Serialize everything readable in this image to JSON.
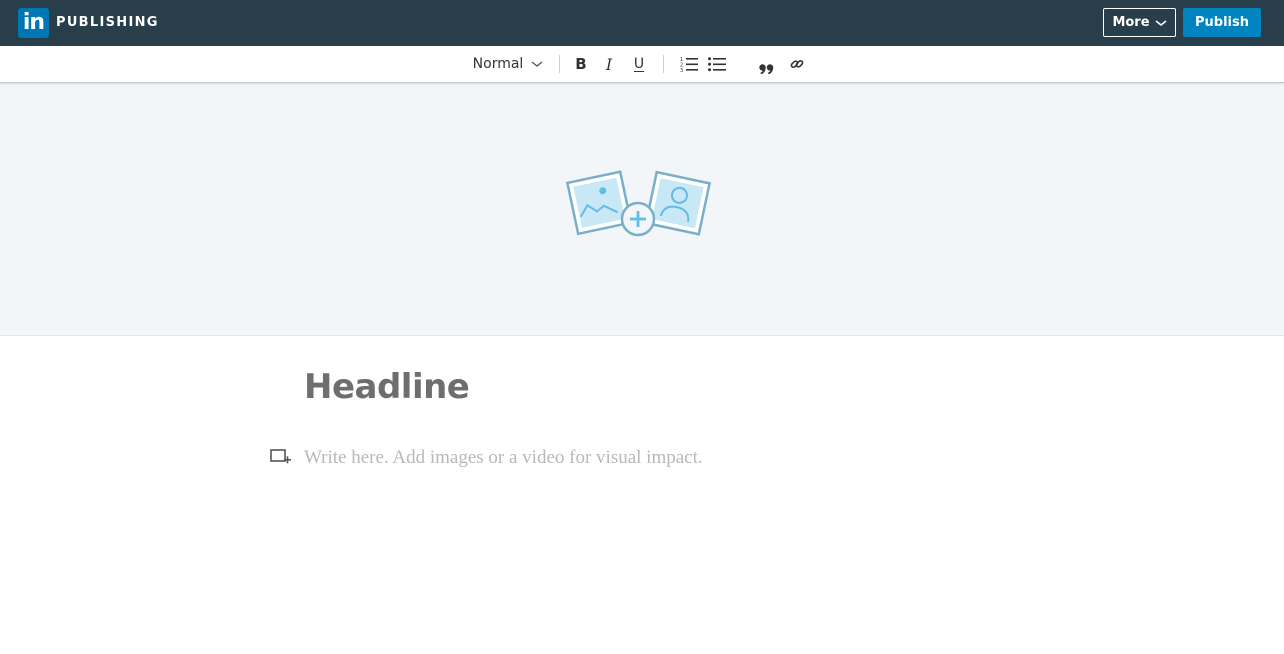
{
  "header": {
    "logo_text": "in",
    "brand": "PUBLISHING",
    "more_label": "More",
    "publish_label": "Publish"
  },
  "toolbar": {
    "style_selected": "Normal",
    "bold_glyph": "B",
    "italic_glyph": "I",
    "underline_glyph": "U",
    "quote_glyph": "❞❞"
  },
  "editor": {
    "headline_placeholder": "Headline",
    "body_placeholder": "Write here. Add images or a video for visual impact."
  },
  "icons": {
    "more": "chevron-down-icon",
    "style": "chevron-down-icon",
    "ordered_list": "numbered-list-icon",
    "unordered_list": "bulleted-list-icon",
    "quote": "quote-icon",
    "link": "link-icon",
    "cover": "add-cover-image-icon",
    "insert": "insert-media-icon"
  },
  "colors": {
    "topbar": "#283e4a",
    "brand_blue": "#0077b5",
    "publish": "#0084bf",
    "cover_bg": "#f3f6f8"
  }
}
